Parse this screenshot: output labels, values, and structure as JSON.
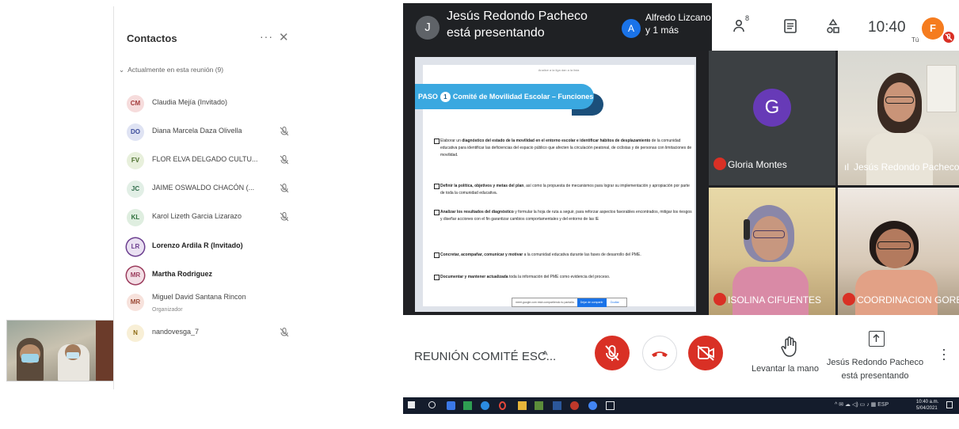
{
  "contacts": {
    "title": "Contactos",
    "more": "···",
    "close": "✕",
    "section": "Actualmente en esta reunión (9)",
    "people": [
      {
        "initials": "CM",
        "name": "Claudia Mejía (Invitado)",
        "bg": "#f6dcdc",
        "fg": "#a33b3b",
        "bold": false,
        "muted": false
      },
      {
        "initials": "DO",
        "name": "Diana Marcela Daza Olivella",
        "bg": "#dfe3f3",
        "fg": "#3b4c9b",
        "bold": false,
        "muted": true
      },
      {
        "initials": "FV",
        "name": "FLOR ELVA DELGADO CULTU...",
        "bg": "#e8f0dc",
        "fg": "#4b6e2d",
        "bold": false,
        "muted": true
      },
      {
        "initials": "JC",
        "name": "JAIME OSWALDO CHACÓN (...",
        "bg": "#e2efe6",
        "fg": "#2f6b49",
        "bold": false,
        "muted": true
      },
      {
        "initials": "KL",
        "name": "Karol Lizeth Garcia Lizarazo",
        "bg": "#dfeee0",
        "fg": "#2e6f3c",
        "bold": false,
        "muted": true
      },
      {
        "initials": "LR",
        "name": "Lorenzo Ardila R (Invitado)",
        "bg": "#eae1f2",
        "fg": "#6b3e8f",
        "bold": true,
        "muted": false
      },
      {
        "initials": "MR",
        "name": "Martha Rodriguez",
        "bg": "#f3dfe6",
        "fg": "#9b3b5c",
        "bold": true,
        "muted": false
      },
      {
        "initials": "MR",
        "name": "Miguel David Santana Rincon",
        "sub": "Organizador",
        "bg": "#f7e2dc",
        "fg": "#9b4a36",
        "bold": false,
        "muted": false
      },
      {
        "initials": "N",
        "name": "nandovesga_7",
        "bg": "#f8efd6",
        "fg": "#8d6a12",
        "bold": false,
        "muted": true
      }
    ]
  },
  "meet": {
    "presenter_initial": "J",
    "presenter_banner": "Jesús Redondo Pacheco está presentando",
    "others_initial": "A",
    "others_label": "Alfredo Lizcano y 1 más",
    "people_count": "8",
    "time": "10:40",
    "me_initial": "F",
    "me_label": "Tú",
    "slide": {
      "top_text": "Analice a la liga dan a la lista",
      "step_prefix": "PASO",
      "step_number": "1",
      "step_title": "Comité de Movilidad Escolar – Funciones",
      "bullets": [
        {
          "pre": "Elaborar un ",
          "bold": "diagnóstico del estado de la movilidad en el entorno escolar e identificar hábitos de desplazamiento",
          "post": " de la comunidad educativa para identificar las deficiencias del espacio público que afecten la circulación peatonal, de ciclistas y de personas con limitaciones de movilidad."
        },
        {
          "pre": "",
          "bold": "Definir la política, objetivos y metas del plan",
          "post": ", así como la propuesta de mecanismos para lograr su implementación y apropiación por parte de toda la comunidad educativa."
        },
        {
          "pre": "",
          "bold": "Analizar los resultados del diagnóstico",
          "post": " y formular la hoja de ruta a seguir, para reforzar aspectos favorables encontrados, mitigar los riesgos y diseñar acciones con el fin garantizar cambios comportamentales y del entorno de las IE"
        },
        {
          "pre": "",
          "bold": "Concretar, acompañar, comunicar y motivar",
          "post": " a la comunidad educativa durante las fases de desarrollo del PME."
        },
        {
          "pre": "",
          "bold": "Documentar y mantener actualizada",
          "post": " toda la información del PME como evidencia del proceso."
        }
      ],
      "share_text": "meet.google.com está compartiendo tu pantalla.",
      "share_stop": "Dejar de compartir",
      "share_hide": "Ocultar"
    },
    "tiles": {
      "gloria_initial": "G",
      "gloria": "Gloria Montes",
      "jesus": "Jesús Redondo Pacheco",
      "isolina": "ISOLINA CIFUENTES",
      "coord": "COORDINACION GORE..."
    },
    "bottom": {
      "meeting_name": "REUNIÓN COMITÉ ESC...",
      "raise_hand": "Levantar la mano",
      "presenting": "Jesús Redondo Pacheco está presentando"
    },
    "taskbar": {
      "lang": "ESP",
      "time": "10:40 a.m.",
      "date": "5/04/2021"
    }
  },
  "colors": {
    "meet_red": "#d93025",
    "presenter_bar": "#1f2124",
    "slide_header": "#3aa8e0"
  },
  "icons": [
    "people-icon",
    "chat-icon",
    "activities-icon",
    "mic-off-icon",
    "hangup-icon",
    "camera-off-icon",
    "raise-hand-icon",
    "present-icon",
    "more-vert-icon",
    "muted-mic-icon"
  ]
}
